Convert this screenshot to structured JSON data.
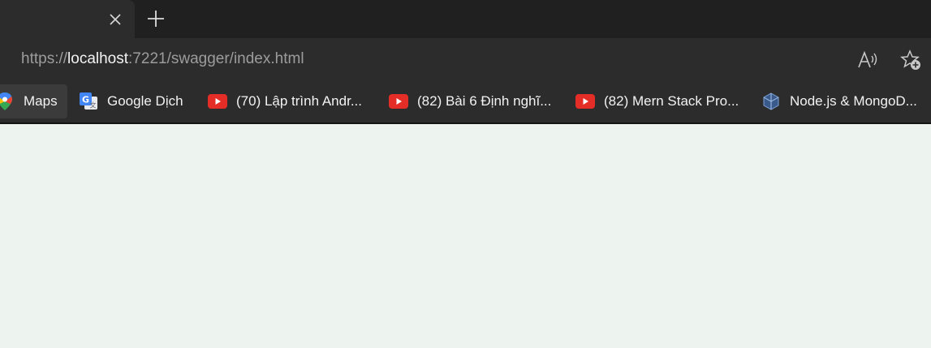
{
  "tab": {
    "close_icon": "close-icon"
  },
  "new_tab_icon": "plus-icon",
  "address_bar": {
    "scheme": "https://",
    "host": "localhost",
    "rest": ":7221/swagger/index.html"
  },
  "toolbar_icons": [
    "read-aloud-icon",
    "add-favorite-icon"
  ],
  "bookmarks": [
    {
      "label": "Maps",
      "icon": "google-maps-icon"
    },
    {
      "label": "Google Dịch",
      "icon": "google-translate-icon"
    },
    {
      "label": "(70) Lập trình Andr...",
      "icon": "youtube-icon"
    },
    {
      "label": "(82) Bài 6 Định nghĩ...",
      "icon": "youtube-icon"
    },
    {
      "label": "(82) Mern Stack Pro...",
      "icon": "youtube-icon"
    },
    {
      "label": "Node.js & MongoD...",
      "icon": "cube-icon"
    }
  ],
  "colors": {
    "tabstrip": "#202020",
    "toolbar": "#2c2c2c",
    "page_background": "#edf3ef",
    "youtube_red": "#e52d27"
  }
}
